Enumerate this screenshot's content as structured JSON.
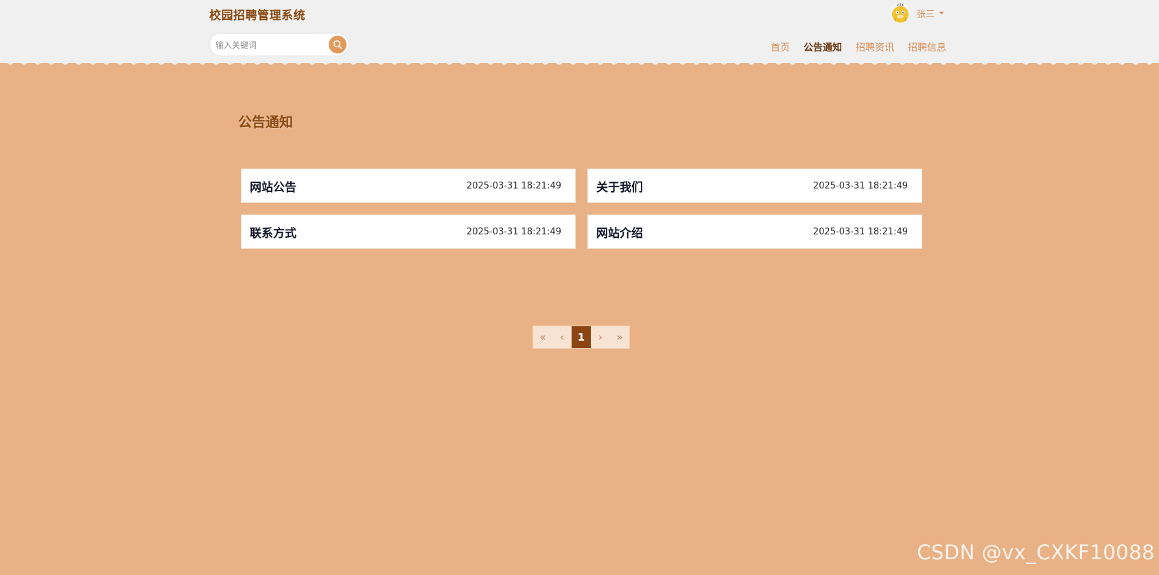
{
  "header": {
    "site_title": "校园招聘管理系统",
    "search": {
      "placeholder": "输入关键词",
      "value": ""
    },
    "user": {
      "name": "张三"
    },
    "nav": [
      {
        "label": "首页",
        "active": false
      },
      {
        "label": "公告通知",
        "active": true
      },
      {
        "label": "招聘资讯",
        "active": false
      },
      {
        "label": "招聘信息",
        "active": false
      }
    ]
  },
  "main": {
    "heading": "公告通知",
    "notices": [
      {
        "title": "网站公告",
        "date": "2025-03-31 18:21:49"
      },
      {
        "title": "关于我们",
        "date": "2025-03-31 18:21:49"
      },
      {
        "title": "联系方式",
        "date": "2025-03-31 18:21:49"
      },
      {
        "title": "网站介绍",
        "date": "2025-03-31 18:21:49"
      }
    ],
    "pagination": {
      "first": "«",
      "prev": "‹",
      "current": "1",
      "next": "›",
      "last": "»"
    }
  },
  "watermark": "CSDN @vx_CXKF10088",
  "colors": {
    "background": "#e9b186",
    "header_bg": "#f0f0f0",
    "accent": "#8b4513",
    "nav_text": "#d88c55"
  },
  "icons": {
    "search_button": "search-icon",
    "avatar": "duck-avatar-icon",
    "dropdown": "caret-down-icon"
  }
}
